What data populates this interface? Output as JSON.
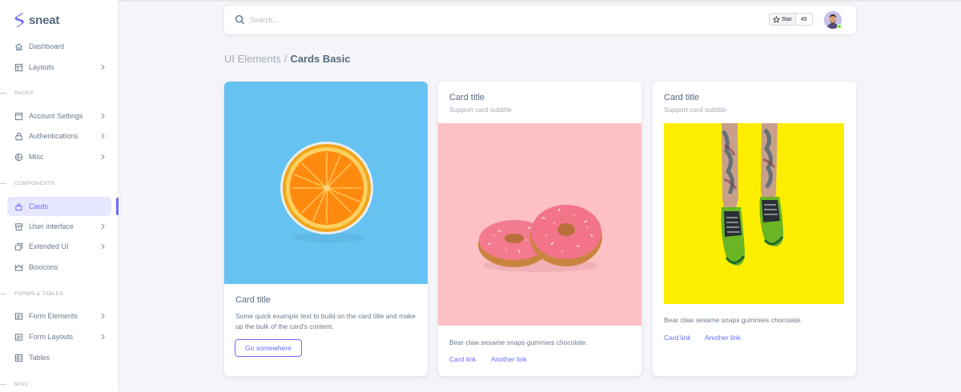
{
  "brand": {
    "name": "sneat",
    "accent": "#696cff"
  },
  "sidebar": {
    "items": [
      {
        "label": "Dashboard",
        "icon": "home-icon"
      },
      {
        "label": "Layouts",
        "icon": "layout-icon"
      },
      {
        "label": "Account Settings",
        "icon": "dock-icon"
      },
      {
        "label": "Authentications",
        "icon": "lock-icon"
      },
      {
        "label": "Misc",
        "icon": "cube-icon"
      },
      {
        "label": "Cards",
        "icon": "collection-icon"
      },
      {
        "label": "User interface",
        "icon": "box-icon"
      },
      {
        "label": "Extended UI",
        "icon": "copy-icon"
      },
      {
        "label": "Boxicons",
        "icon": "crown-icon"
      },
      {
        "label": "Form Elements",
        "icon": "detail-icon"
      },
      {
        "label": "Form Layouts",
        "icon": "detail-icon"
      },
      {
        "label": "Tables",
        "icon": "table-icon"
      }
    ],
    "headers": {
      "pages": "PAGES",
      "components": "COMPONENTS",
      "forms_tables": "FORMS & TABLES",
      "misc": "MISC"
    }
  },
  "navbar": {
    "search_placeholder": "Search...",
    "star_label": "Star",
    "star_count": "49"
  },
  "breadcrumb": {
    "parent": "UI Elements",
    "separator": "/",
    "current": "Cards Basic"
  },
  "cards": [
    {
      "title": "Card title",
      "text": "Some quick example text to build on the card title and make up the bulk of the card's content.",
      "button": "Go somewhere",
      "image_bg": "#66c2f1"
    },
    {
      "title": "Card title",
      "subtitle": "Support card subtitle",
      "text": "Bear claw sesame snaps gummies chocolate.",
      "link1": "Card link",
      "link2": "Another link",
      "image_bg": "#fdc1c5"
    },
    {
      "title": "Card title",
      "subtitle": "Support card subtitle",
      "text": "Bear claw sesame snaps gummies chocolate.",
      "link1": "Card link",
      "link2": "Another link",
      "image_bg": "#fdee00"
    }
  ]
}
